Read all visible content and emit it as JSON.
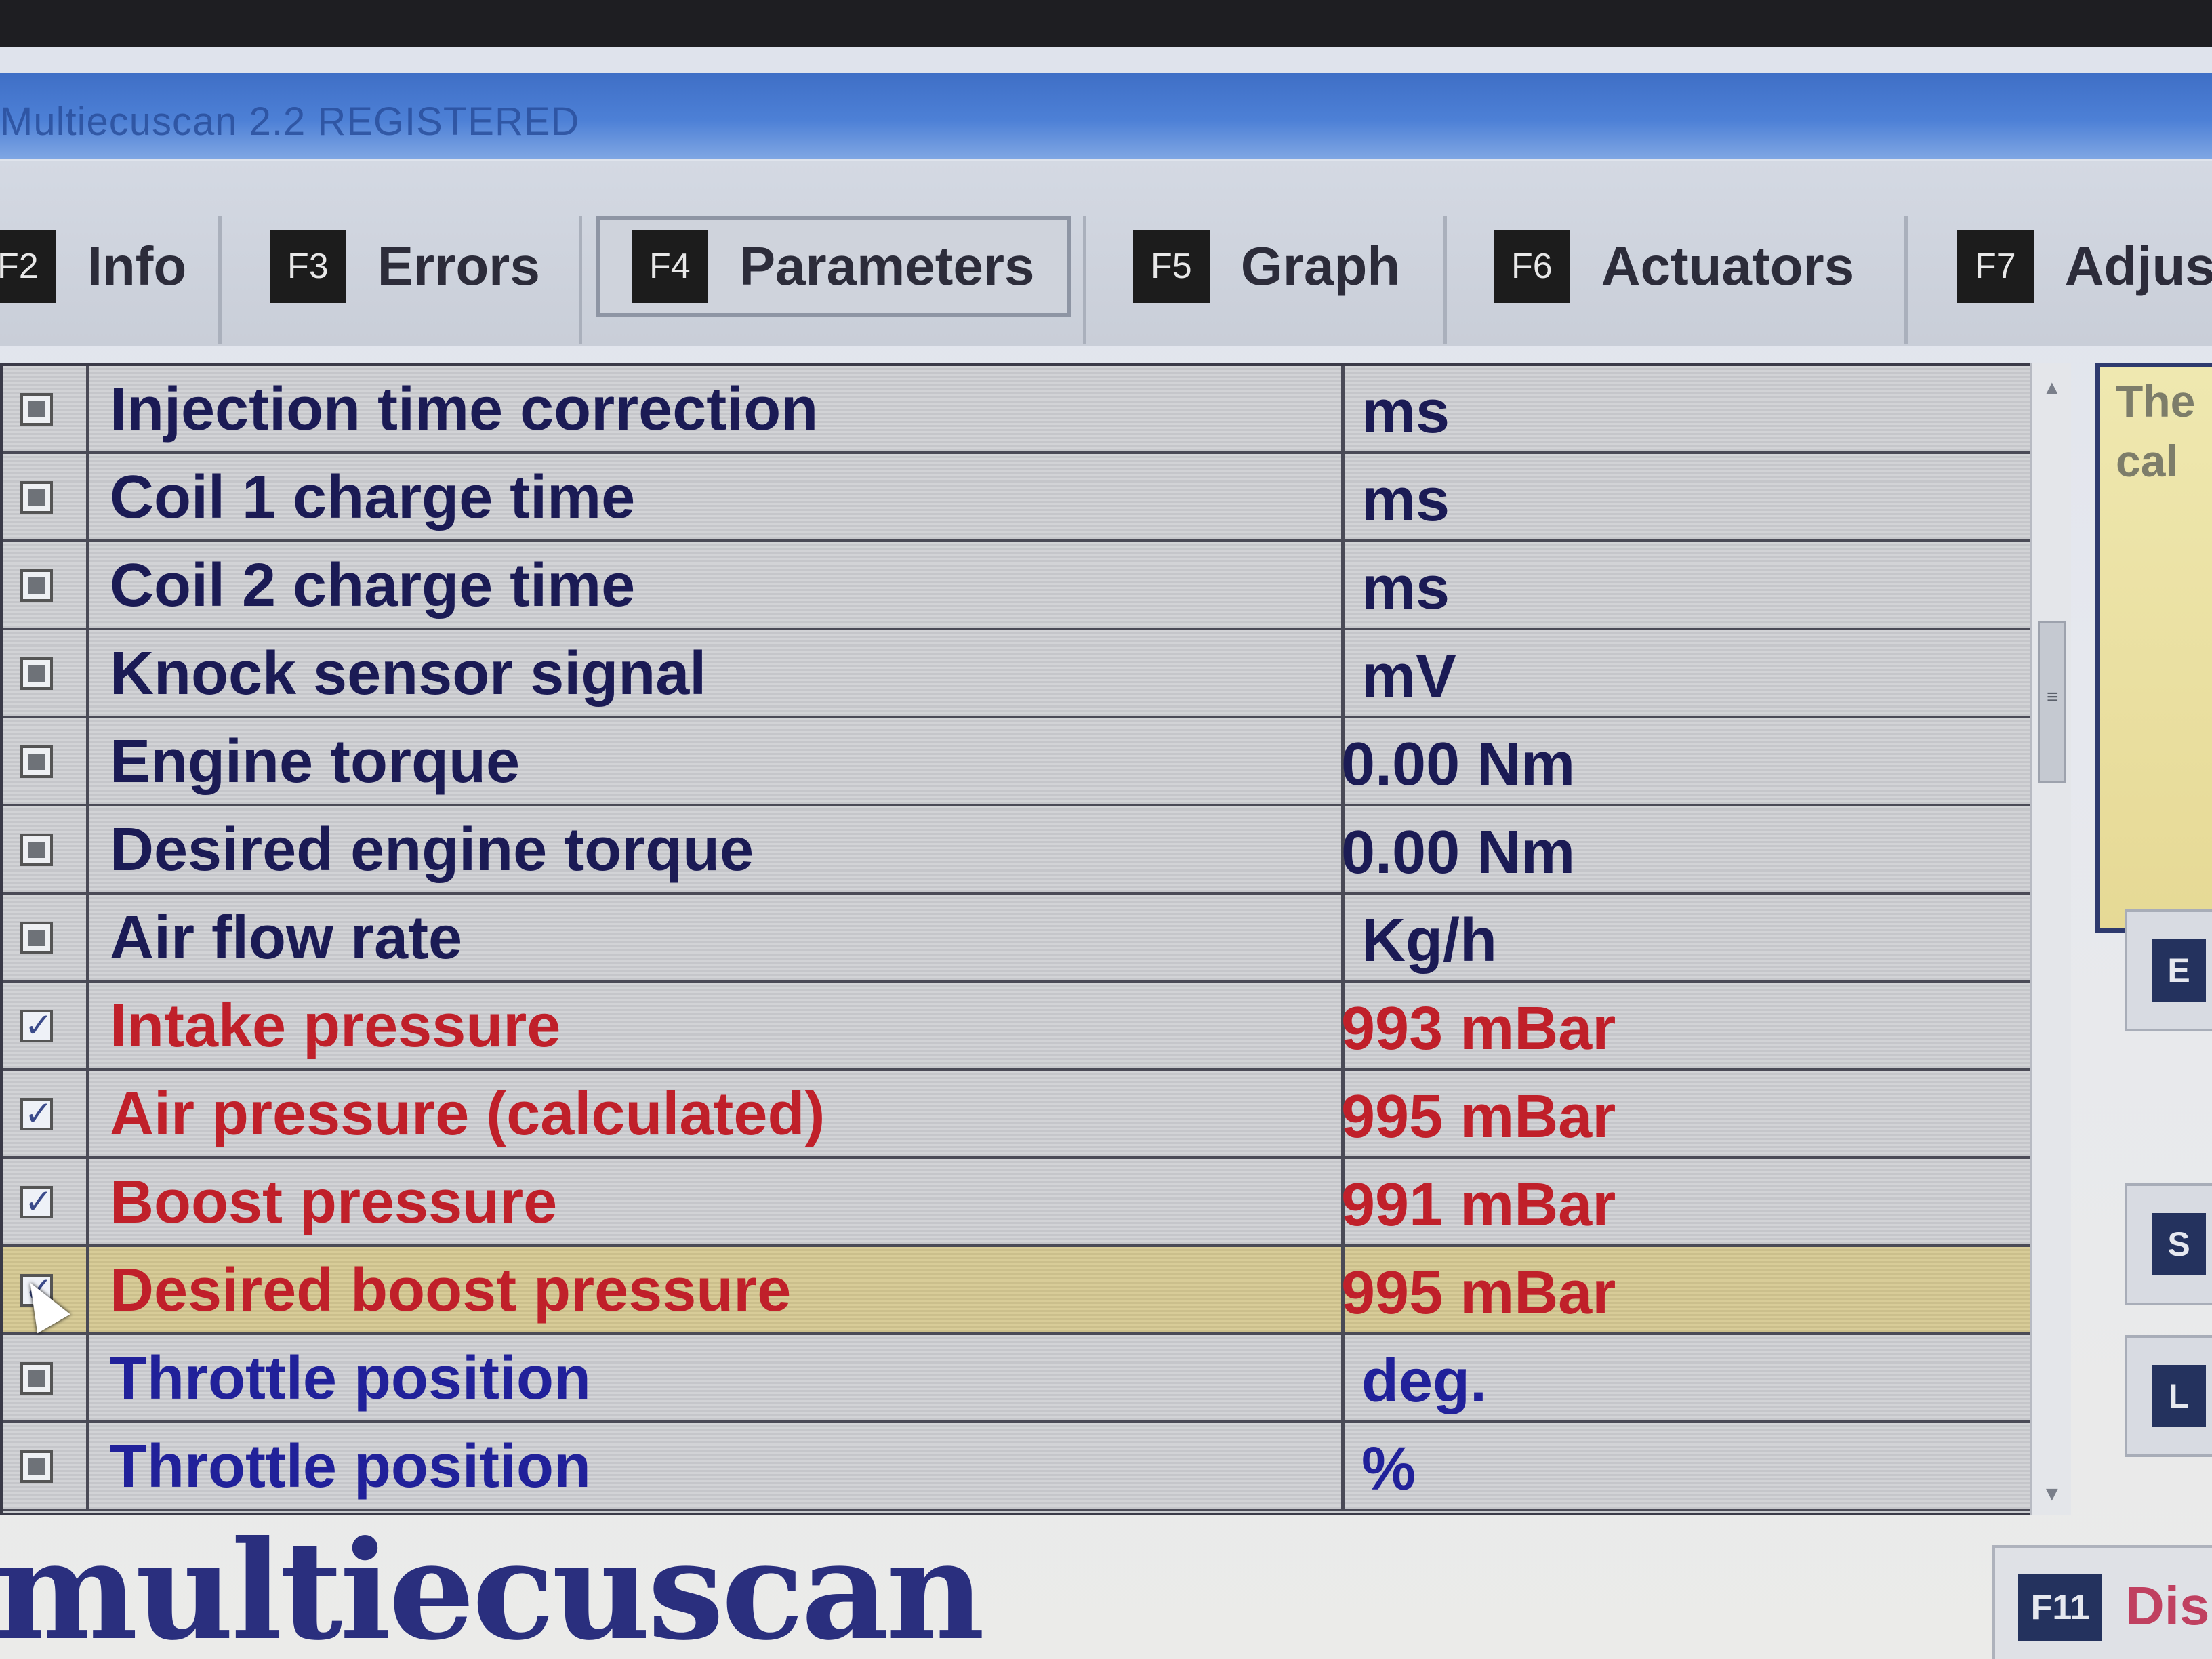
{
  "window": {
    "title": "Multiecuscan 2.2 REGISTERED"
  },
  "tabs": [
    {
      "key": "F2",
      "label": "Info"
    },
    {
      "key": "F3",
      "label": "Errors"
    },
    {
      "key": "F4",
      "label": "Parameters",
      "active": true
    },
    {
      "key": "F5",
      "label": "Graph"
    },
    {
      "key": "F6",
      "label": "Actuators"
    },
    {
      "key": "F7",
      "label": "Adjus"
    }
  ],
  "parameters": [
    {
      "name": "Injection time correction",
      "value": "ms",
      "checked": false,
      "color": "dark"
    },
    {
      "name": "Coil 1 charge time",
      "value": "ms",
      "checked": false,
      "color": "dark"
    },
    {
      "name": "Coil 2 charge time",
      "value": "ms",
      "checked": false,
      "color": "dark"
    },
    {
      "name": "Knock sensor signal",
      "value": "mV",
      "checked": false,
      "color": "dark"
    },
    {
      "name": "Engine torque",
      "value": "0.00 Nm",
      "checked": false,
      "color": "dark"
    },
    {
      "name": "Desired engine torque",
      "value": "0.00 Nm",
      "checked": false,
      "color": "dark"
    },
    {
      "name": "Air flow rate",
      "value": "Kg/h",
      "checked": false,
      "color": "dark"
    },
    {
      "name": "Intake pressure",
      "value": "993 mBar",
      "checked": true,
      "color": "red"
    },
    {
      "name": "Air pressure (calculated)",
      "value": "995 mBar",
      "checked": true,
      "color": "red"
    },
    {
      "name": "Boost pressure",
      "value": "991 mBar",
      "checked": true,
      "color": "red"
    },
    {
      "name": "Desired boost pressure",
      "value": "995 mBar",
      "checked": true,
      "color": "red",
      "selected": true
    },
    {
      "name": "Throttle position",
      "value": "deg.",
      "checked": false,
      "color": "blue"
    },
    {
      "name": "Throttle position",
      "value": "%",
      "checked": false,
      "color": "blue"
    }
  ],
  "side_panel": {
    "note": "The\ncal"
  },
  "side_buttons": [
    {
      "key": "E"
    },
    {
      "key": "S"
    },
    {
      "key": "L"
    }
  ],
  "footer": {
    "logo": "multiecuscan",
    "button_key": "F11",
    "button_label": "Dis"
  },
  "colors": {
    "dark": "#1b1b55",
    "blue": "#21219a",
    "red": "#c0202a",
    "highlight": "#d8cc98",
    "titlebar": "#4d80d6"
  },
  "icons": {
    "scroll_up": "triangle-up",
    "scroll_down": "triangle-down",
    "scroll_grip": "grip-lines",
    "cursor": "mouse-pointer"
  }
}
